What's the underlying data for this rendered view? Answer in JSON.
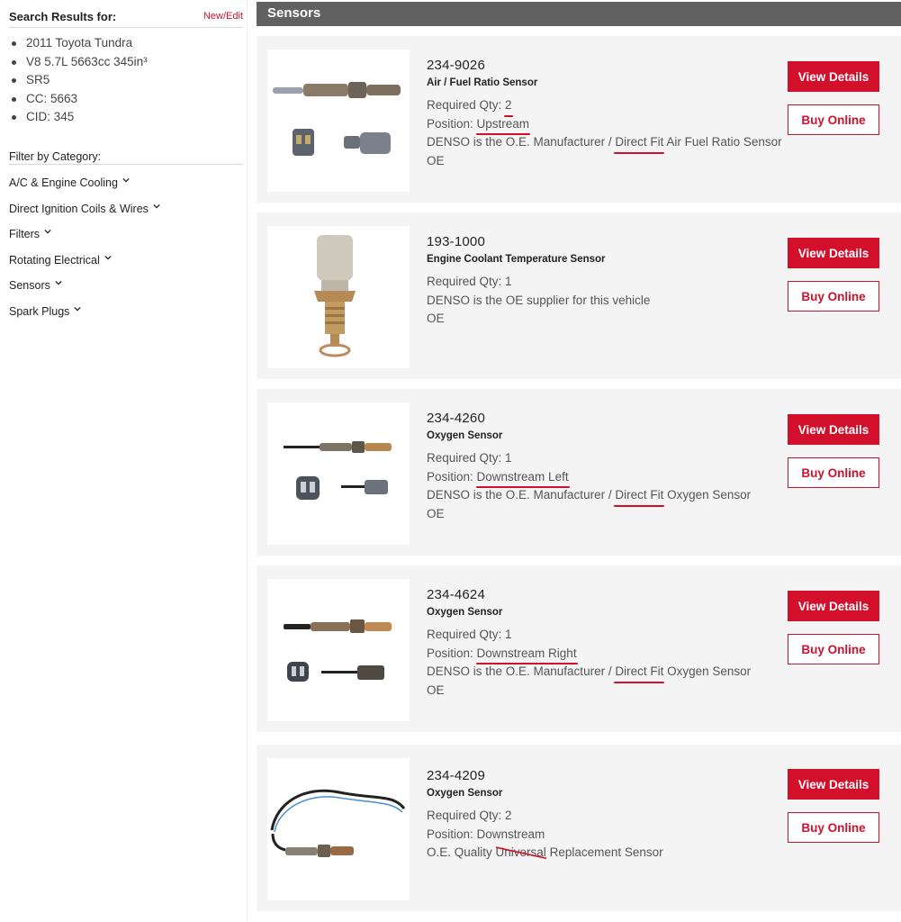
{
  "sidebar": {
    "search_results_label": "Search Results for:",
    "new_edit_link": "New/Edit",
    "vehicle": [
      "2011 Toyota Tundra",
      "V8 5.7L 5663cc 345in³",
      "SR5",
      "CC: 5663",
      "CID: 345"
    ],
    "filter_label": "Filter by Category:",
    "categories": [
      "A/C & Engine Cooling",
      "Direct Ignition Coils & Wires",
      "Filters",
      "Rotating Electrical",
      "Sensors",
      "Spark Plugs"
    ]
  },
  "section": {
    "title": "Sensors"
  },
  "buttons": {
    "view_details": "View Details",
    "buy_online": "Buy Online"
  },
  "products": [
    {
      "part_number": "234-9026",
      "name": "Air / Fuel Ratio Sensor",
      "qty_label": "Required Qty: ",
      "qty": "2",
      "position_label": "Position: ",
      "position": "Upstream",
      "supplier_prefix": "DENSO is the O.E. Manufacturer / ",
      "fit": "Direct Fit",
      "supplier_suffix": " Air Fuel Ratio Sensor",
      "oe": "OE"
    },
    {
      "part_number": "193-1000",
      "name": "Engine Coolant Temperature Sensor",
      "qty_line": "Required Qty: 1",
      "supplier_line": "DENSO is the OE supplier for this vehicle",
      "oe": "OE"
    },
    {
      "part_number": "234-4260",
      "name": "Oxygen Sensor",
      "qty_line": "Required Qty: 1",
      "position_label": "Position: ",
      "position": "Downstream Left",
      "supplier_prefix": "DENSO is the O.E. Manufacturer / ",
      "fit": "Direct Fit",
      "supplier_suffix": " Oxygen Sensor",
      "oe": "OE"
    },
    {
      "part_number": "234-4624",
      "name": "Oxygen Sensor",
      "qty_line": "Required Qty: 1",
      "position_label": "Position: ",
      "position": "Downstream Right",
      "supplier_prefix": "DENSO is the O.E. Manufacturer / ",
      "fit": "Direct Fit",
      "supplier_suffix": " Oxygen Sensor",
      "oe": "OE"
    },
    {
      "part_number": "234-4209",
      "name": "Oxygen Sensor",
      "qty_line": "Required Qty: 2",
      "position_line": "Position: Downstream",
      "quality_prefix": "O.E. Quality ",
      "struck_word": "Universal",
      "quality_suffix": " Replacement Sensor"
    }
  ]
}
